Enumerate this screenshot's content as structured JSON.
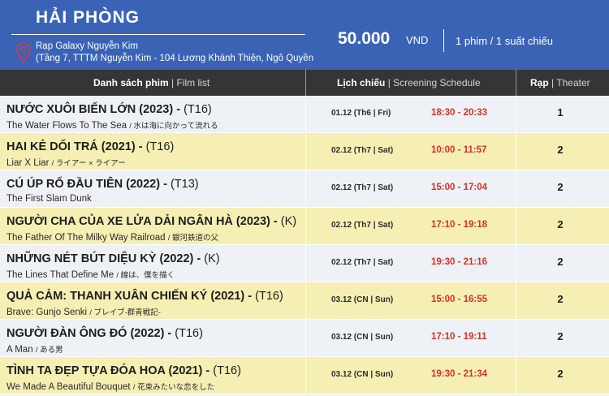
{
  "header": {
    "city": "HẢI PHÒNG",
    "cinema_name": "Rạp Galaxy Nguyễn Kim",
    "cinema_address": "(Tầng 7, TTTM Nguyễn Kim - 104 Lương Khánh Thiện, Ngô Quyền",
    "price": "50.000",
    "currency": "VND",
    "rule": "1 phim / 1 suất chiếu",
    "pin_icon": "location-pin-icon",
    "accent_color": "#3a63b6"
  },
  "columns": {
    "film_vi": "Danh sách phim",
    "film_en": "Film list",
    "schedule_vi": "Lịch chiếu",
    "schedule_en": "Screening Schedule",
    "theater_vi": "Rạp",
    "theater_en": "Theater",
    "sep": "|"
  },
  "films": [
    {
      "title": "NƯỚC XUÔI BIỂN LỚN (2023) -",
      "rating": "(T16)",
      "en": "The Water Flows To The Sea",
      "jp": "/ 水は海に向かって流れる",
      "date": "01.12 (Th6 | Fri)",
      "time": "18:30 - 20:33",
      "theater": "1"
    },
    {
      "title": "HAI KẺ DỐI TRÁ (2021) -",
      "rating": "(T16)",
      "en": "Liar X Liar",
      "jp": "/ ライアー × ライアー",
      "date": "02.12 (Th7 | Sat)",
      "time": "10:00 - 11:57",
      "theater": "2"
    },
    {
      "title": "CÚ ÚP RỔ ĐẦU TIÊN  (2022) -",
      "rating": "(T13)",
      "en": "The First Slam Dunk",
      "jp": "",
      "date": "02.12 (Th7 | Sat)",
      "time": "15:00 - 17:04",
      "theater": "2"
    },
    {
      "title": "NGƯỜI CHA CỦA XE LỬA DẢI NGÂN HÀ  (2023) -",
      "rating": "(K)",
      "en": "The Father Of The Milky Way Railroad",
      "jp": "/ 銀河鉄道の父",
      "date": "02.12 (Th7 | Sat)",
      "time": "17:10 - 19:18",
      "theater": "2"
    },
    {
      "title": "NHỮNG NÉT BÚT DIỆU KỲ (2022) -",
      "rating": "(K)",
      "en": "The Lines That Define Me",
      "jp": "/ 線は、僕を描く",
      "date": "02.12 (Th7 | Sat)",
      "time": "19:30 - 21:16",
      "theater": "2"
    },
    {
      "title": "QUẢ CẢM: THANH XUÂN CHIẾN KÝ (2021) -",
      "rating": "(T16)",
      "en": "Brave: Gunjo Senki",
      "jp": "/ ブレイブ-群青戦記-",
      "date": "03.12 (CN | Sun)",
      "time": "15:00 - 16:55",
      "theater": "2"
    },
    {
      "title": "NGƯỜI ĐÀN ÔNG ĐÓ (2022) -",
      "rating": "(T16)",
      "en": "A Man",
      "jp": "/ ある男",
      "date": "03.12 (CN | Sun)",
      "time": "17:10 - 19:11",
      "theater": "2"
    },
    {
      "title": "TÌNH TA ĐẸP TỰA ĐÓA HOA (2021) -",
      "rating": "(T16)",
      "en": "We Made A Beautiful Bouquet",
      "jp": "/ 花束みたいな恋をした",
      "date": "03.12 (CN | Sun)",
      "time": "19:30 - 21:34",
      "theater": "2"
    }
  ]
}
